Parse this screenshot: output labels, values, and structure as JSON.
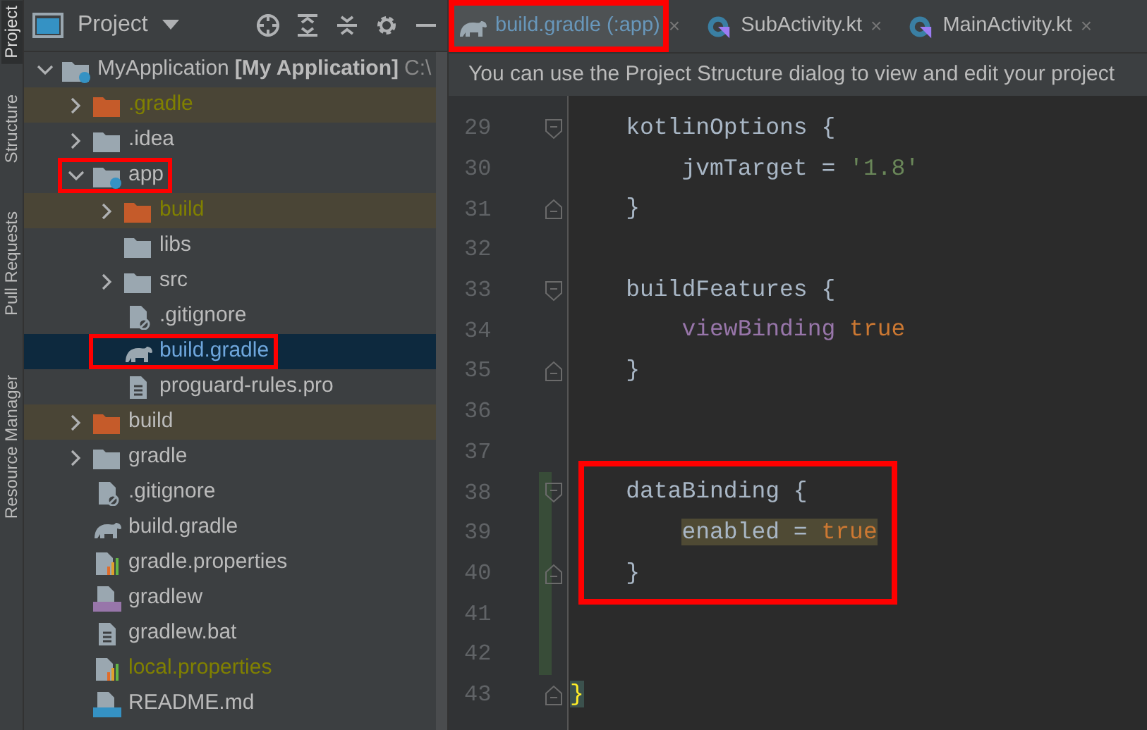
{
  "tool_strip": [
    {
      "label": "Project",
      "selected": true
    },
    {
      "label": "Structure",
      "selected": false
    },
    {
      "label": "Pull Requests",
      "selected": false
    },
    {
      "label": "Resource Manager",
      "selected": false
    }
  ],
  "project_panel": {
    "title": "Project",
    "tree": [
      {
        "name": "MyApplication",
        "module": "[My Application]",
        "path": "C:\\",
        "kind": "module-folder",
        "expanded": true,
        "selected": false,
        "ignored": false,
        "annotated": false,
        "children": [
          {
            "name": ".gradle",
            "kind": "excluded-folder",
            "expanded": false,
            "selected": false,
            "ignored": true,
            "annotated": false
          },
          {
            "name": ".idea",
            "kind": "folder",
            "expanded": false,
            "selected": false,
            "ignored": false,
            "annotated": false
          },
          {
            "name": "app",
            "kind": "module-folder",
            "expanded": true,
            "selected": false,
            "ignored": false,
            "annotated": true,
            "children": [
              {
                "name": "build",
                "kind": "excluded-folder",
                "expanded": false,
                "selected": false,
                "ignored": true,
                "annotated": false
              },
              {
                "name": "libs",
                "kind": "folder",
                "selected": false,
                "ignored": false,
                "annotated": false
              },
              {
                "name": "src",
                "kind": "folder",
                "expanded": false,
                "selected": false,
                "ignored": false,
                "annotated": false
              },
              {
                "name": ".gitignore",
                "kind": "gitignore",
                "selected": false,
                "ignored": false,
                "annotated": false
              },
              {
                "name": "build.gradle",
                "kind": "gradle",
                "selected": true,
                "ignored": false,
                "annotated": true
              },
              {
                "name": "proguard-rules.pro",
                "kind": "text",
                "selected": false,
                "ignored": false,
                "annotated": false
              }
            ]
          },
          {
            "name": "build",
            "kind": "excluded-folder",
            "expanded": false,
            "selected": false,
            "ignored": false,
            "annotated": false
          },
          {
            "name": "gradle",
            "kind": "folder",
            "expanded": false,
            "selected": false,
            "ignored": false,
            "annotated": false
          },
          {
            "name": ".gitignore",
            "kind": "gitignore",
            "selected": false,
            "ignored": false,
            "annotated": false
          },
          {
            "name": "build.gradle",
            "kind": "gradle",
            "selected": false,
            "ignored": false,
            "annotated": false
          },
          {
            "name": "gradle.properties",
            "kind": "properties",
            "selected": false,
            "ignored": false,
            "annotated": false
          },
          {
            "name": "gradlew",
            "kind": "shell",
            "selected": false,
            "ignored": false,
            "annotated": false
          },
          {
            "name": "gradlew.bat",
            "kind": "text",
            "selected": false,
            "ignored": false,
            "annotated": false
          },
          {
            "name": "local.properties",
            "kind": "properties",
            "selected": false,
            "ignored": true,
            "annotated": false
          },
          {
            "name": "README.md",
            "kind": "markdown",
            "selected": false,
            "ignored": false,
            "annotated": false
          }
        ]
      }
    ]
  },
  "editor": {
    "tabs": [
      {
        "label": "build.gradle (:app)",
        "kind": "gradle",
        "selected": true,
        "annotated": true,
        "close": "×"
      },
      {
        "label": "SubActivity.kt",
        "kind": "kotlin",
        "selected": false,
        "annotated": false,
        "close": "×"
      },
      {
        "label": "MainActivity.kt",
        "kind": "kotlin",
        "selected": false,
        "annotated": false,
        "close": "×"
      }
    ],
    "banner": "You can use the Project Structure dialog to view and edit your project",
    "lines": [
      {
        "number": "29",
        "kind": "fold-start",
        "changed": false,
        "annotated": false,
        "tokens": [
          {
            "kind": "plain",
            "text": "    kotlinOptions {"
          }
        ]
      },
      {
        "number": "30",
        "kind": "plain",
        "changed": false,
        "annotated": false,
        "tokens": [
          {
            "kind": "plain",
            "text": "        jvmTarget = "
          },
          {
            "kind": "string",
            "text": "'1.8'"
          }
        ]
      },
      {
        "number": "31",
        "kind": "fold-end",
        "changed": false,
        "annotated": false,
        "tokens": [
          {
            "kind": "plain",
            "text": "    }"
          }
        ]
      },
      {
        "number": "32",
        "kind": "plain",
        "changed": false,
        "annotated": false
      },
      {
        "number": "33",
        "kind": "fold-start",
        "changed": false,
        "annotated": false,
        "tokens": [
          {
            "kind": "plain",
            "text": "    buildFeatures {"
          }
        ]
      },
      {
        "number": "34",
        "kind": "plain",
        "changed": false,
        "annotated": false,
        "tokens": [
          {
            "kind": "property",
            "text": "        viewBinding"
          },
          {
            "kind": "keyword",
            "text": " true"
          }
        ]
      },
      {
        "number": "35",
        "kind": "fold-end",
        "changed": false,
        "annotated": false,
        "tokens": [
          {
            "kind": "plain",
            "text": "    }"
          }
        ]
      },
      {
        "number": "36",
        "kind": "plain",
        "changed": false,
        "annotated": false
      },
      {
        "number": "37",
        "kind": "plain",
        "changed": false,
        "annotated": false
      },
      {
        "number": "38",
        "kind": "fold-start",
        "changed": true,
        "annotated": true,
        "tokens": [
          {
            "kind": "plain",
            "text": "    dataBinding {"
          }
        ]
      },
      {
        "number": "39",
        "kind": "plain",
        "changed": true,
        "annotated": true,
        "tokens": [
          {
            "kind": "highlight",
            "text": "        enabled = "
          },
          {
            "kind": "highlight-keyword",
            "text": "true"
          }
        ]
      },
      {
        "number": "40",
        "kind": "fold-end",
        "changed": true,
        "annotated": true,
        "tokens": [
          {
            "kind": "plain",
            "text": "    }"
          }
        ]
      },
      {
        "number": "41",
        "kind": "plain",
        "changed": true,
        "annotated": false
      },
      {
        "number": "42",
        "kind": "plain",
        "changed": true,
        "annotated": false
      },
      {
        "number": "43",
        "kind": "fold-end",
        "changed": false,
        "annotated": false,
        "tokens": [
          {
            "kind": "brace-match",
            "text": "}"
          }
        ]
      }
    ]
  }
}
